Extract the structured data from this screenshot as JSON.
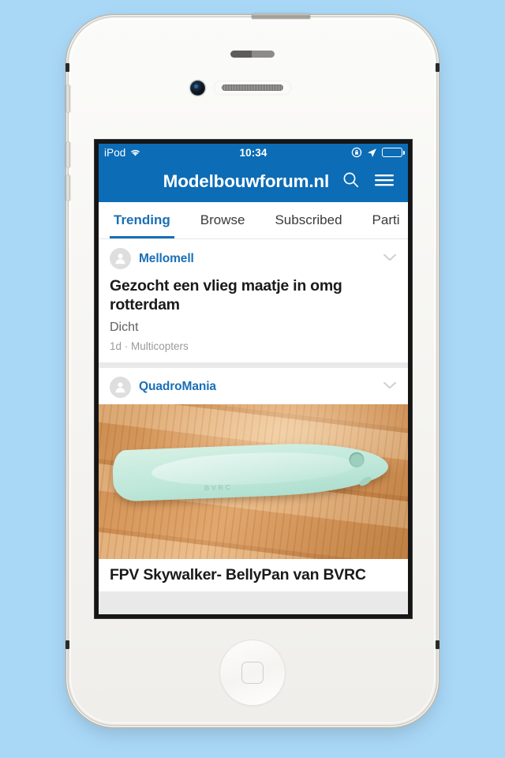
{
  "device": {
    "name": "iPod touch",
    "hardware": {
      "power_button": "power-button",
      "volume_up": "volume-up-button",
      "volume_down": "volume-down-button",
      "mute_switch": "mute-switch",
      "home_button": "home-button",
      "front_camera": "front-camera",
      "earpiece": "earpiece-speaker",
      "proximity_sensor": "proximity-sensor"
    },
    "background_color": "#a9d8f7",
    "body_color": "#f6f5f2"
  },
  "status_bar": {
    "carrier": "iPod",
    "wifi_icon": "wifi-icon",
    "time": "10:34",
    "rotation_lock_icon": "rotation-lock-icon",
    "location_icon": "location-arrow-icon",
    "battery_icon": "battery-icon",
    "battery_level": "100",
    "background_color": "#0c6cb5"
  },
  "nav_bar": {
    "title": "Modelbouwforum.nl",
    "search_icon": "search-icon",
    "menu_icon": "hamburger-menu-icon",
    "background_color": "#0c6cb5",
    "text_color": "#ffffff"
  },
  "tabs": {
    "active_index": 0,
    "accent_color": "#1a6fb5",
    "items": [
      {
        "label": "Trending"
      },
      {
        "label": "Browse"
      },
      {
        "label": "Subscribed"
      },
      {
        "label": "Parti"
      }
    ]
  },
  "feed": {
    "posts": [
      {
        "author": "Mellomell",
        "avatar_icon": "user-avatar-icon",
        "expand_icon": "chevron-down-icon",
        "title": "Gezocht een vlieg maatje in omg rotterdam",
        "snippet": "Dicht",
        "meta": "1d · Multicopters",
        "has_photo": false
      },
      {
        "author": "QuadroMania",
        "avatar_icon": "user-avatar-icon",
        "expand_icon": "chevron-down-icon",
        "photo_alt": "Mint green fiberglass belly pan lying on a light wood laminate floor",
        "photo_emboss_text": "BVRC",
        "title": "FPV Skywalker- BellyPan van BVRC",
        "has_photo": true
      }
    ]
  }
}
